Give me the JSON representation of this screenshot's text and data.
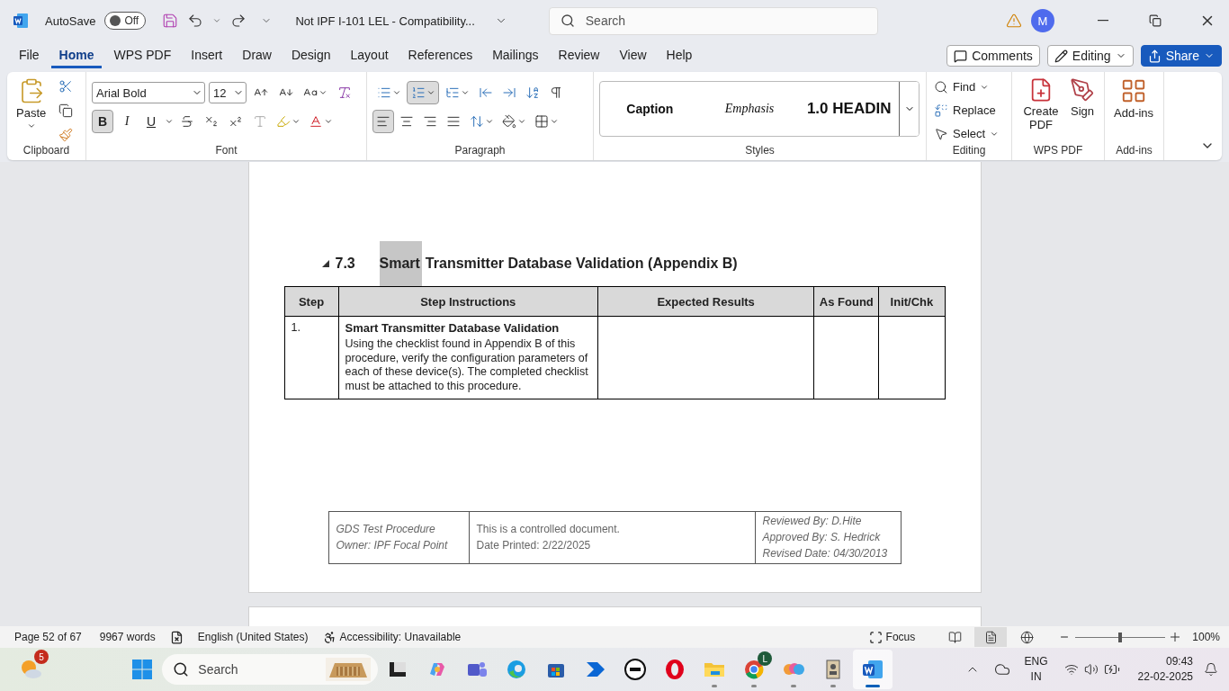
{
  "title_bar": {
    "autosave_label": "AutoSave",
    "autosave": {
      "on": false,
      "label": "Off"
    },
    "document_title": "Not IPF I-101 LEL  -  Compatibility...",
    "search_placeholder": "Search",
    "avatar": "M"
  },
  "tabs": [
    {
      "label": "File",
      "selected": false
    },
    {
      "label": "Home",
      "selected": true
    },
    {
      "label": "WPS PDF",
      "selected": false
    },
    {
      "label": "Insert",
      "selected": false
    },
    {
      "label": "Draw",
      "selected": false
    },
    {
      "label": "Design",
      "selected": false
    },
    {
      "label": "Layout",
      "selected": false
    },
    {
      "label": "References",
      "selected": false
    },
    {
      "label": "Mailings",
      "selected": false
    },
    {
      "label": "Review",
      "selected": false
    },
    {
      "label": "View",
      "selected": false
    },
    {
      "label": "Help",
      "selected": false
    }
  ],
  "actions": {
    "comments": "Comments",
    "editing": "Editing",
    "share": "Share"
  },
  "ribbon": {
    "clipboard": {
      "paste": "Paste",
      "label": "Clipboard"
    },
    "font": {
      "name": "Arial Bold",
      "size": "12",
      "label": "Font",
      "format": [
        {
          "label": "B",
          "kind": "bold",
          "selected": true
        },
        {
          "label": "I",
          "kind": "italic",
          "selected": false
        },
        {
          "label": "U",
          "kind": "underline",
          "selected": false
        }
      ]
    },
    "paragraph": {
      "label": "Paragraph",
      "lists": [
        {
          "kind": "bullets",
          "selected": false
        },
        {
          "kind": "numbering",
          "selected": true
        },
        {
          "kind": "multilevel",
          "selected": false
        }
      ],
      "alignments": [
        {
          "kind": "left",
          "selected": true
        },
        {
          "kind": "center",
          "selected": false
        },
        {
          "kind": "right",
          "selected": false
        },
        {
          "kind": "justify",
          "selected": false
        }
      ]
    },
    "styles": {
      "label": "Styles",
      "items": [
        {
          "label": "Caption",
          "kind": "bold"
        },
        {
          "label": "Emphasis",
          "kind": "italic"
        },
        {
          "label": "1.0  HEADIN",
          "kind": "heading"
        }
      ]
    },
    "editing": {
      "label": "Editing",
      "find": "Find",
      "replace": "Replace",
      "select": "Select"
    },
    "wps_pdf": {
      "label": "WPS PDF",
      "create": "Create PDF",
      "sign": "Sign"
    },
    "addins": {
      "label": "Add-ins",
      "button": "Add-ins"
    }
  },
  "document": {
    "heading": {
      "expanded": true,
      "number": "7.3",
      "parts": [
        {
          "text": "Smart",
          "selected": true
        },
        {
          "text": "Transmitter Database Validation (Appendix B)",
          "selected": false
        }
      ]
    },
    "table": {
      "columns": [
        "Step",
        "Step Instructions",
        "Expected Results",
        "As Found",
        "Init/Chk"
      ],
      "rows": [
        {
          "step": "1.",
          "title": "Smart Transmitter Database Validation",
          "text": "Using the checklist found in Appendix B of this procedure, verify the configuration parameters of each of these device(s). The completed checklist must be attached to this procedure."
        }
      ]
    },
    "footer": {
      "left": [
        "GDS Test Procedure",
        "Owner: IPF Focal Point"
      ],
      "middle": [
        "This is a controlled document.",
        "Date Printed: 2/22/2025"
      ],
      "right": [
        "Reviewed By: D.Hite",
        "Approved By: S. Hedrick",
        "Revised Date: 04/30/2013"
      ]
    }
  },
  "status_bar": {
    "page": "Page 52 of 67",
    "words": "9967 words",
    "language": "English (United States)",
    "accessibility": "Accessibility: Unavailable",
    "focus": "Focus",
    "views": [
      {
        "kind": "read",
        "selected": false
      },
      {
        "kind": "print",
        "selected": true
      },
      {
        "kind": "web",
        "selected": false
      }
    ],
    "zoom": {
      "level": 0.5,
      "reading": "100%"
    }
  },
  "taskbar": {
    "weather_badge": "5",
    "search_placeholder": "Search",
    "apps": [
      {
        "kind": "tiles",
        "running": false,
        "selected": false
      },
      {
        "kind": "copilot",
        "running": false,
        "selected": false
      },
      {
        "kind": "teams",
        "running": false,
        "selected": false
      },
      {
        "kind": "edge",
        "running": false,
        "selected": false
      },
      {
        "kind": "store",
        "running": false,
        "selected": false
      },
      {
        "kind": "automate",
        "running": false,
        "selected": false
      },
      {
        "kind": "dell",
        "running": false,
        "selected": false
      },
      {
        "kind": "opera",
        "running": false,
        "selected": false
      },
      {
        "kind": "files",
        "running": true,
        "selected": false
      },
      {
        "kind": "chrome",
        "running": true,
        "selected": false,
        "badge": "L"
      },
      {
        "kind": "blobs",
        "running": true,
        "selected": false
      },
      {
        "kind": "viewer",
        "running": true,
        "selected": false
      },
      {
        "kind": "word",
        "running": true,
        "selected": true
      }
    ],
    "language": [
      "ENG",
      "IN"
    ],
    "time": "09:43",
    "date": "22-02-2025"
  }
}
